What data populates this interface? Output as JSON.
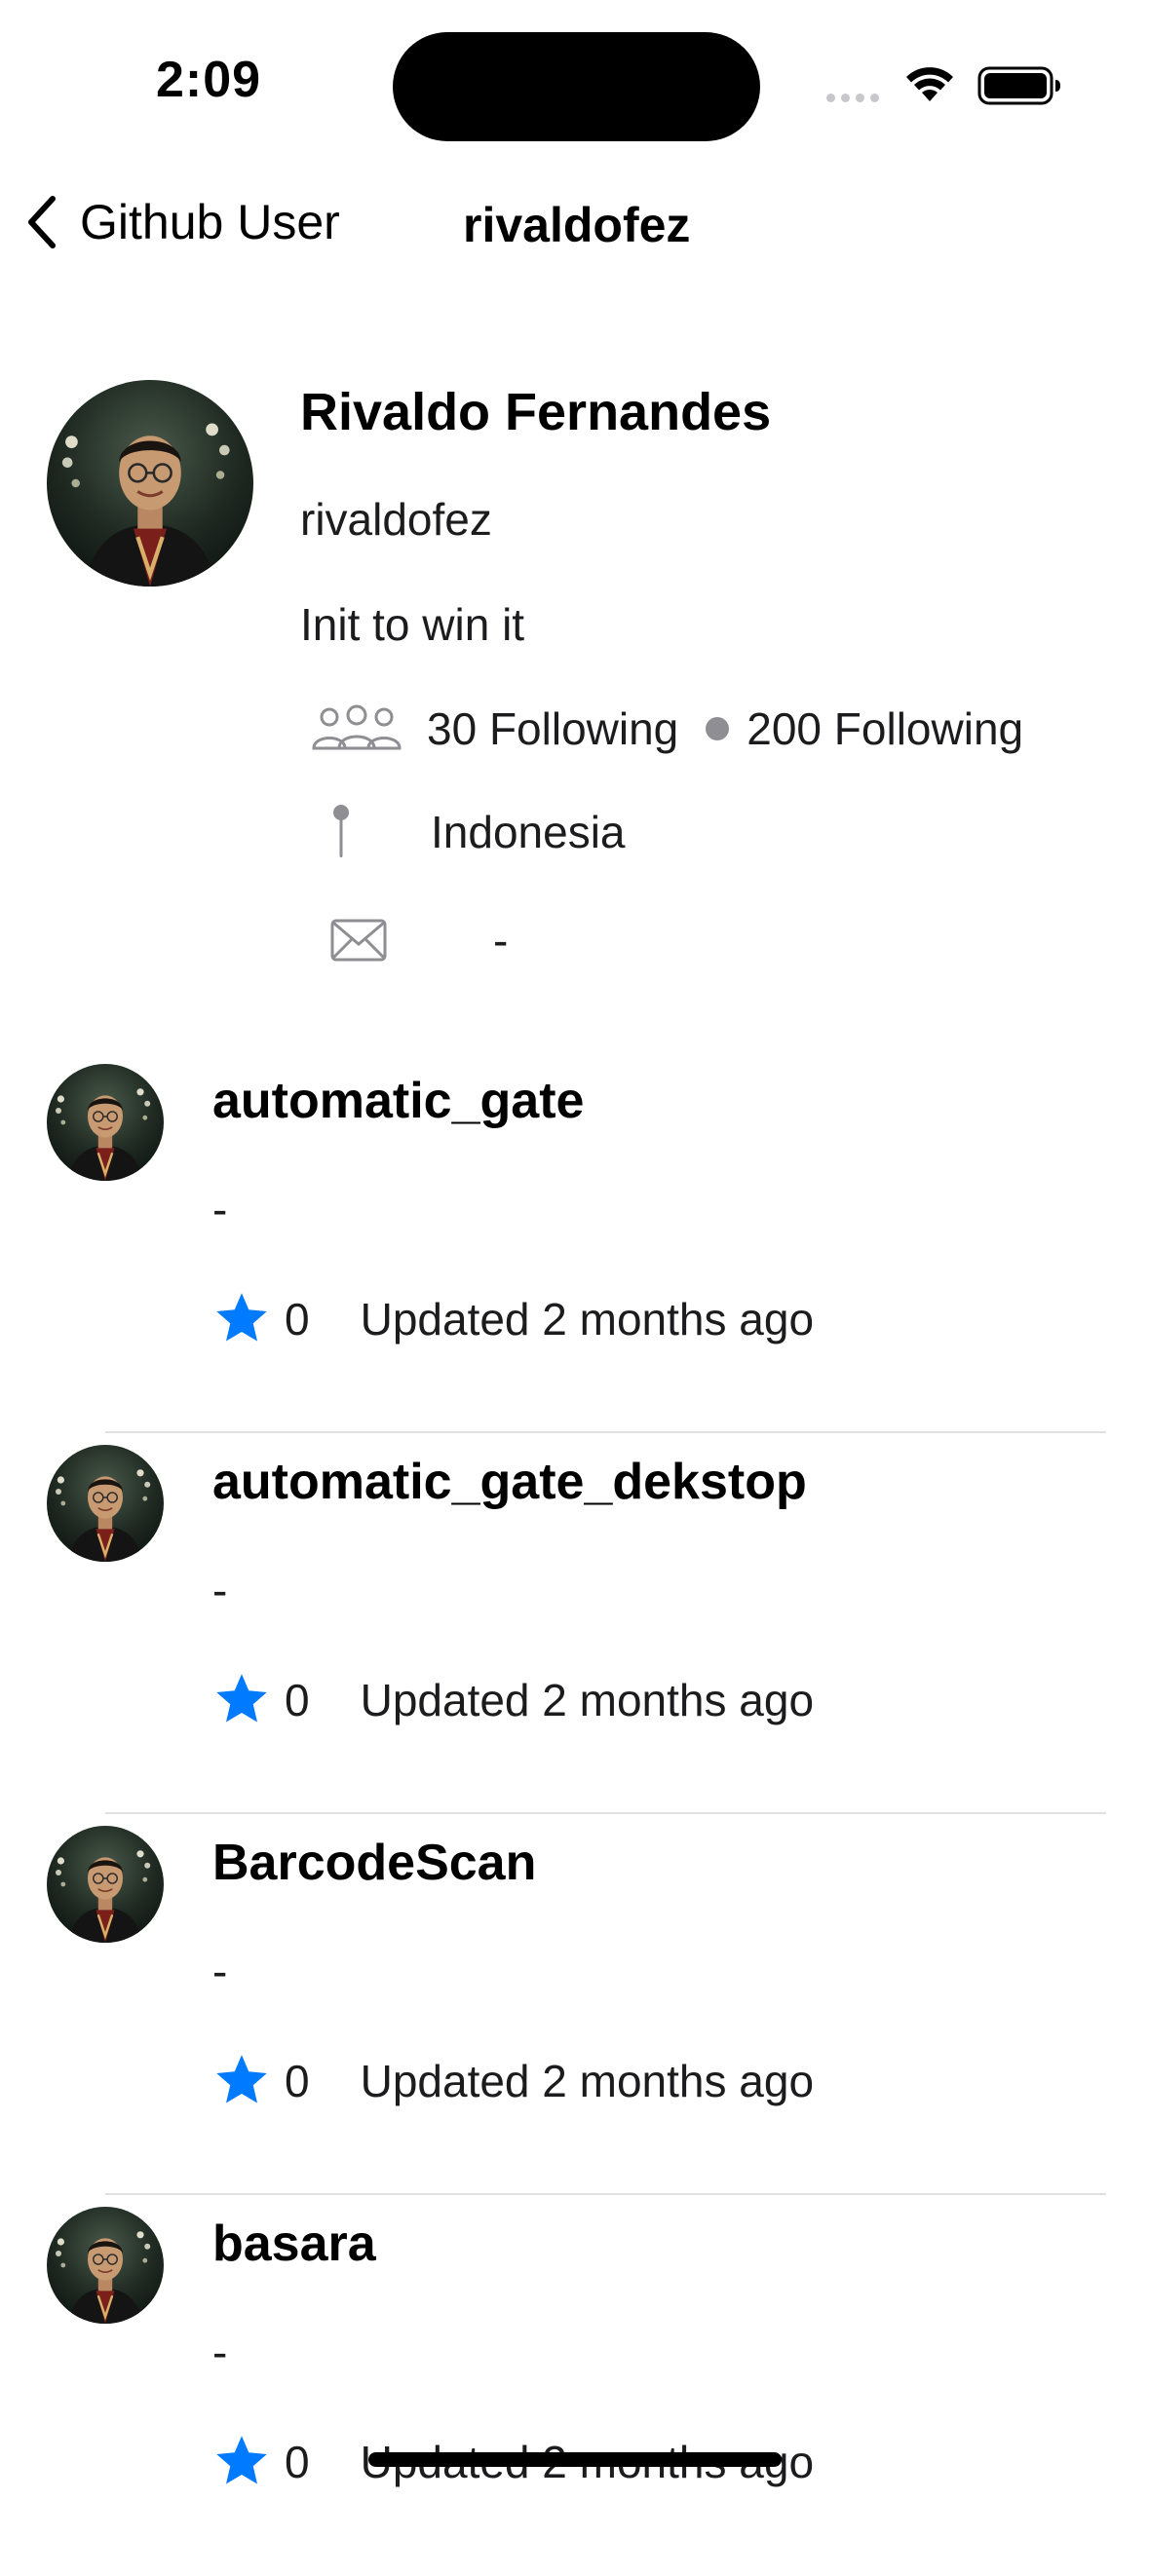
{
  "status_bar": {
    "time": "2:09"
  },
  "nav": {
    "back_label": "Github User",
    "title": "rivaldofez"
  },
  "profile": {
    "name": "Rivaldo Fernandes",
    "username": "rivaldofez",
    "bio": "Init to win it",
    "followers_text": "30 Following",
    "following_text": "200 Following",
    "location": "Indonesia",
    "email": "-"
  },
  "icons": {
    "people": "people-icon",
    "location": "pin-icon",
    "email": "envelope-icon",
    "star": "star-icon",
    "back": "chevron-left-icon"
  },
  "colors": {
    "accent": "#007AFF",
    "secondary_gray": "#8E8E93"
  },
  "repos": [
    {
      "name": "automatic_gate",
      "description": "-",
      "stars": "0",
      "updated": "Updated 2 months ago"
    },
    {
      "name": "automatic_gate_dekstop",
      "description": "-",
      "stars": "0",
      "updated": "Updated 2 months ago"
    },
    {
      "name": "BarcodeScan",
      "description": "-",
      "stars": "0",
      "updated": "Updated 2 months ago"
    },
    {
      "name": "basara",
      "description": "-",
      "stars": "0",
      "updated": "Updated 2 months ago"
    }
  ]
}
